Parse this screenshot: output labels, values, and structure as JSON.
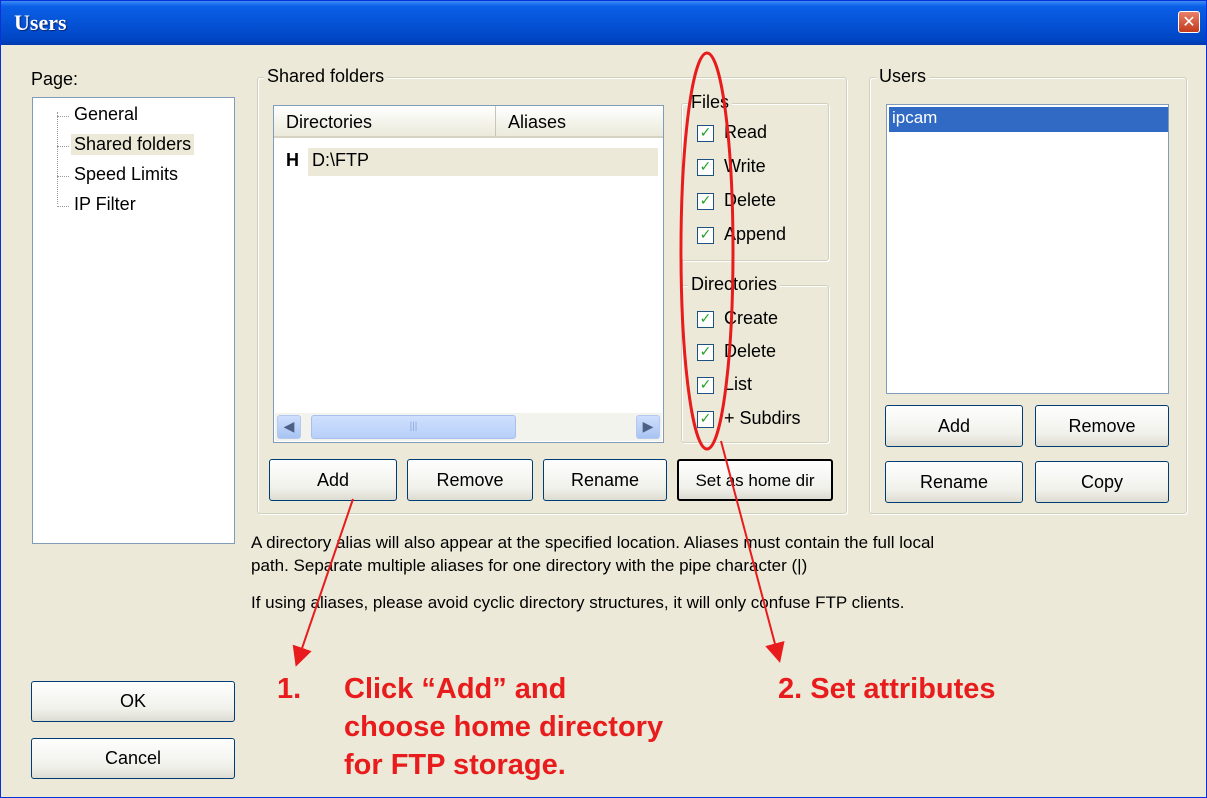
{
  "window": {
    "title": "Users",
    "close_glyph": "✕"
  },
  "page_panel": {
    "label": "Page:",
    "items": [
      "General",
      "Shared folders",
      "Speed Limits",
      "IP Filter"
    ]
  },
  "shared_folders": {
    "legend": "Shared folders",
    "columns": [
      "Directories",
      "Aliases"
    ],
    "rows": [
      {
        "mark": "H",
        "directory": "D:\\FTP",
        "alias": ""
      }
    ],
    "buttons": {
      "add": "Add",
      "remove": "Remove",
      "rename": "Rename",
      "set_home": "Set as home dir"
    }
  },
  "files": {
    "legend": "Files",
    "options": [
      {
        "label": "Read",
        "checked": true
      },
      {
        "label": "Write",
        "checked": true
      },
      {
        "label": "Delete",
        "checked": true
      },
      {
        "label": "Append",
        "checked": true
      }
    ]
  },
  "directories": {
    "legend": "Directories",
    "options": [
      {
        "label": "Create",
        "checked": true
      },
      {
        "label": "Delete",
        "checked": true
      },
      {
        "label": "List",
        "checked": true
      },
      {
        "label": "+ Subdirs",
        "checked": true
      }
    ]
  },
  "users": {
    "legend": "Users",
    "list": [
      "ipcam"
    ],
    "buttons": {
      "add": "Add",
      "remove": "Remove",
      "rename": "Rename",
      "copy": "Copy"
    }
  },
  "info_text": {
    "line1": "A directory alias will also appear at the specified location. Aliases must contain the full local",
    "line2": "path. Separate multiple aliases for one directory with the pipe character (|)",
    "line3": "If using aliases, please avoid cyclic directory structures, it will only confuse FTP clients."
  },
  "dialog_buttons": {
    "ok": "OK",
    "cancel": "Cancel"
  },
  "annotations": {
    "step1_num": "1.",
    "step1_line1": "Click “Add” and",
    "step1_line2": "choose home directory",
    "step1_line3": "for FTP storage.",
    "step2": "2. Set attributes",
    "color": "#e81c1c"
  },
  "colors": {
    "titlebar": "#0553d6",
    "dialog_bg": "#ece9d8",
    "selection": "#316ac5"
  }
}
